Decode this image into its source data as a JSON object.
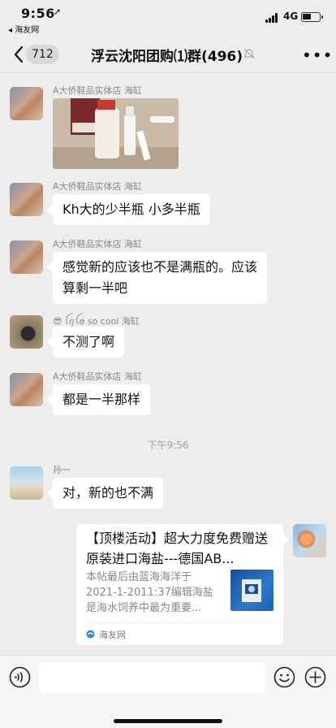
{
  "status_bar": {
    "time": "9:56",
    "location_arrow": "➚",
    "back_app": "◂ 海友网",
    "network": "4G",
    "battery_level": 0.5
  },
  "nav": {
    "unread_count": "712",
    "title": "浮云沈阳团购⑴群(496)",
    "more": "•••"
  },
  "messages": [
    {
      "sender": "A大侨鞋品实体店 海缸",
      "type": "image"
    },
    {
      "sender": "A大侨鞋品实体店 海缸",
      "text": "Kh大的少半瓶 小多半瓶"
    },
    {
      "sender": "A大侨鞋品实体店 海缸",
      "text_line1": "感觉新的应该也不是满瓶的。应该",
      "text_line2": "算剩一半吧"
    },
    {
      "sender": "😎 ꪶꪖꪶꪮ so cool 海缸",
      "text": "不测了啊"
    },
    {
      "sender": "A大侨鞋品实体店 海缸",
      "text": "都是一半那样"
    },
    {
      "sender": "孙一",
      "text": "对，新的也不满"
    }
  ],
  "timestamp": "下午9:56",
  "link_card": {
    "title": "【顶楼活动】超大力度免费赠送原装进口海盐---德国AB...",
    "description": "本帖最后由蓝海海洋于 2021-1-2011:37编辑海盐是海水饲养中最为重要...",
    "source": "海友网"
  },
  "input_bar": {
    "placeholder": ""
  }
}
